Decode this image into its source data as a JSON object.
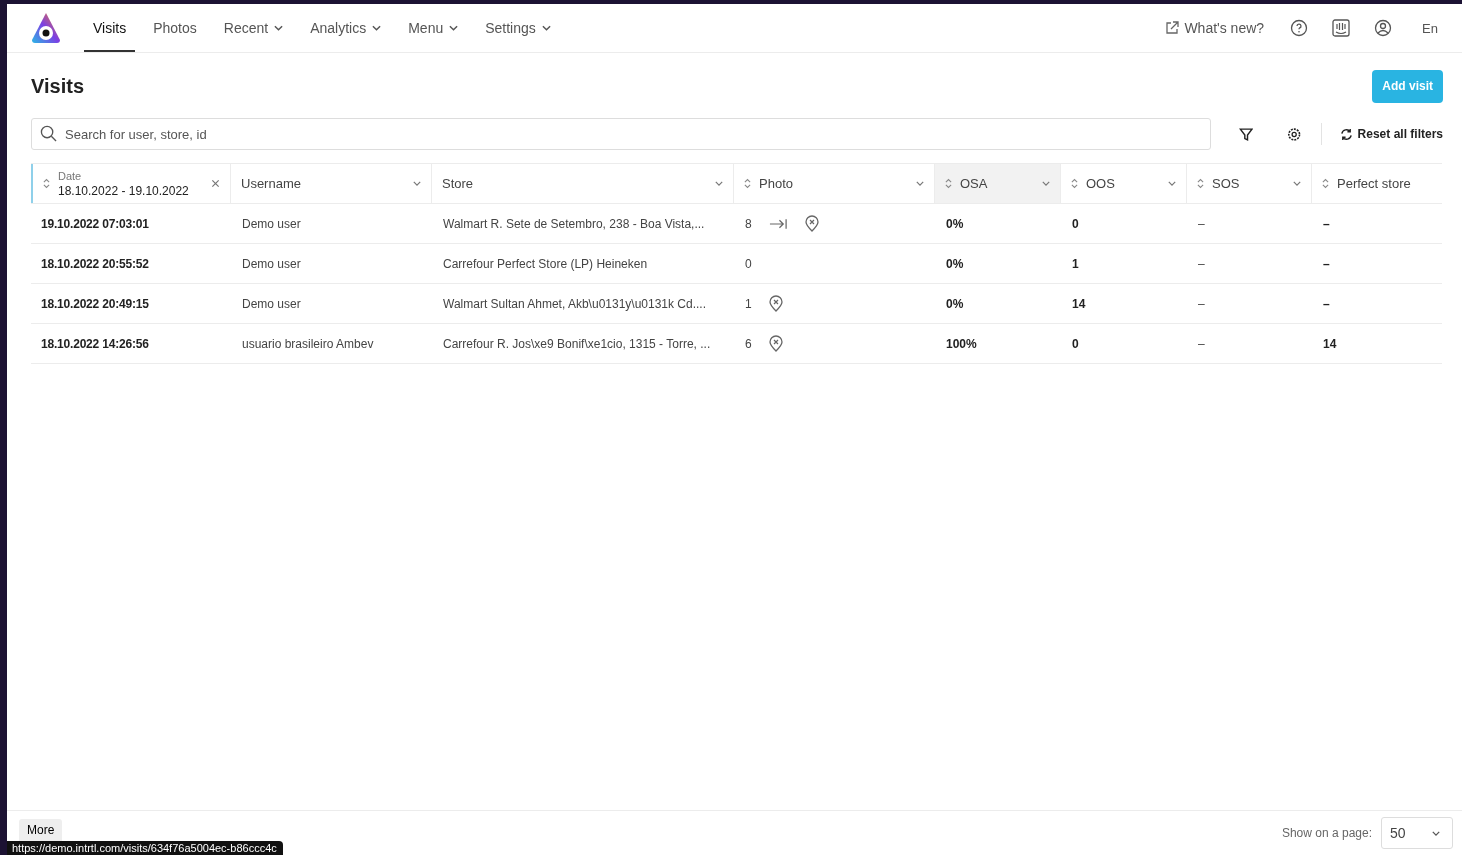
{
  "nav": {
    "items": [
      {
        "label": "Visits",
        "selected": true,
        "dropdown": false
      },
      {
        "label": "Photos",
        "selected": false,
        "dropdown": false
      },
      {
        "label": "Recent",
        "selected": false,
        "dropdown": true
      },
      {
        "label": "Analytics",
        "selected": false,
        "dropdown": true
      },
      {
        "label": "Menu",
        "selected": false,
        "dropdown": true
      },
      {
        "label": "Settings",
        "selected": false,
        "dropdown": true
      }
    ],
    "whats_new": "What's new?",
    "language": "En"
  },
  "page": {
    "title": "Visits",
    "add_button": "Add visit"
  },
  "search": {
    "placeholder": "Search for user, store, id"
  },
  "reset_filters": "Reset all filters",
  "table": {
    "columns": [
      {
        "label": "Date",
        "value": "18.10.2022 - 19.10.2022",
        "sortable": true,
        "dropdown": false,
        "clearable": true,
        "hovered": false
      },
      {
        "label": "Username",
        "sortable": false,
        "dropdown": true,
        "clearable": false,
        "hovered": false
      },
      {
        "label": "Store",
        "sortable": false,
        "dropdown": true,
        "clearable": false,
        "hovered": false
      },
      {
        "label": "Photo",
        "sortable": true,
        "dropdown": true,
        "clearable": false,
        "hovered": false
      },
      {
        "label": "OSA",
        "sortable": true,
        "dropdown": true,
        "clearable": false,
        "hovered": true
      },
      {
        "label": "OOS",
        "sortable": true,
        "dropdown": true,
        "clearable": false,
        "hovered": false
      },
      {
        "label": "SOS",
        "sortable": true,
        "dropdown": true,
        "clearable": false,
        "hovered": false
      },
      {
        "label": "Perfect store",
        "sortable": true,
        "dropdown": false,
        "clearable": false,
        "hovered": false
      }
    ],
    "rows": [
      {
        "date": "19.10.2022 07:03:01",
        "username": "Demo user",
        "store": "Walmart R. Sete de Setembro, 238 - Boa Vista,...",
        "photo": "8",
        "has_arrow": true,
        "has_pin": true,
        "osa": "0%",
        "oos": "0",
        "sos": "–",
        "perfect_store": "–"
      },
      {
        "date": "18.10.2022 20:55:52",
        "username": "Demo user",
        "store": "Carrefour Perfect Store (LP) Heineken",
        "photo": "0",
        "has_arrow": false,
        "has_pin": false,
        "osa": "0%",
        "oos": "1",
        "sos": "–",
        "perfect_store": "–"
      },
      {
        "date": "18.10.2022 20:49:15",
        "username": "Demo user",
        "store": "Walmart Sultan Ahmet, Akb\\u0131y\\u0131k Cd....",
        "photo": "1",
        "has_arrow": false,
        "has_pin": true,
        "osa": "0%",
        "oos": "14",
        "sos": "–",
        "perfect_store": "–"
      },
      {
        "date": "18.10.2022 14:26:56",
        "username": "usuario brasileiro Ambev",
        "store": "Carrefour R. Jos\\xe9 Bonif\\xe1cio, 1315 - Torre, ...",
        "photo": "6",
        "has_arrow": false,
        "has_pin": true,
        "osa": "100%",
        "oos": "0",
        "sos": "–",
        "perfect_store": "14"
      }
    ]
  },
  "footer": {
    "more_button": "More",
    "page_size_label": "Show on a page:",
    "page_size": "50"
  },
  "status_url": "https://demo.intrtl.com/visits/634f76a5004ec-b86ccc4c"
}
